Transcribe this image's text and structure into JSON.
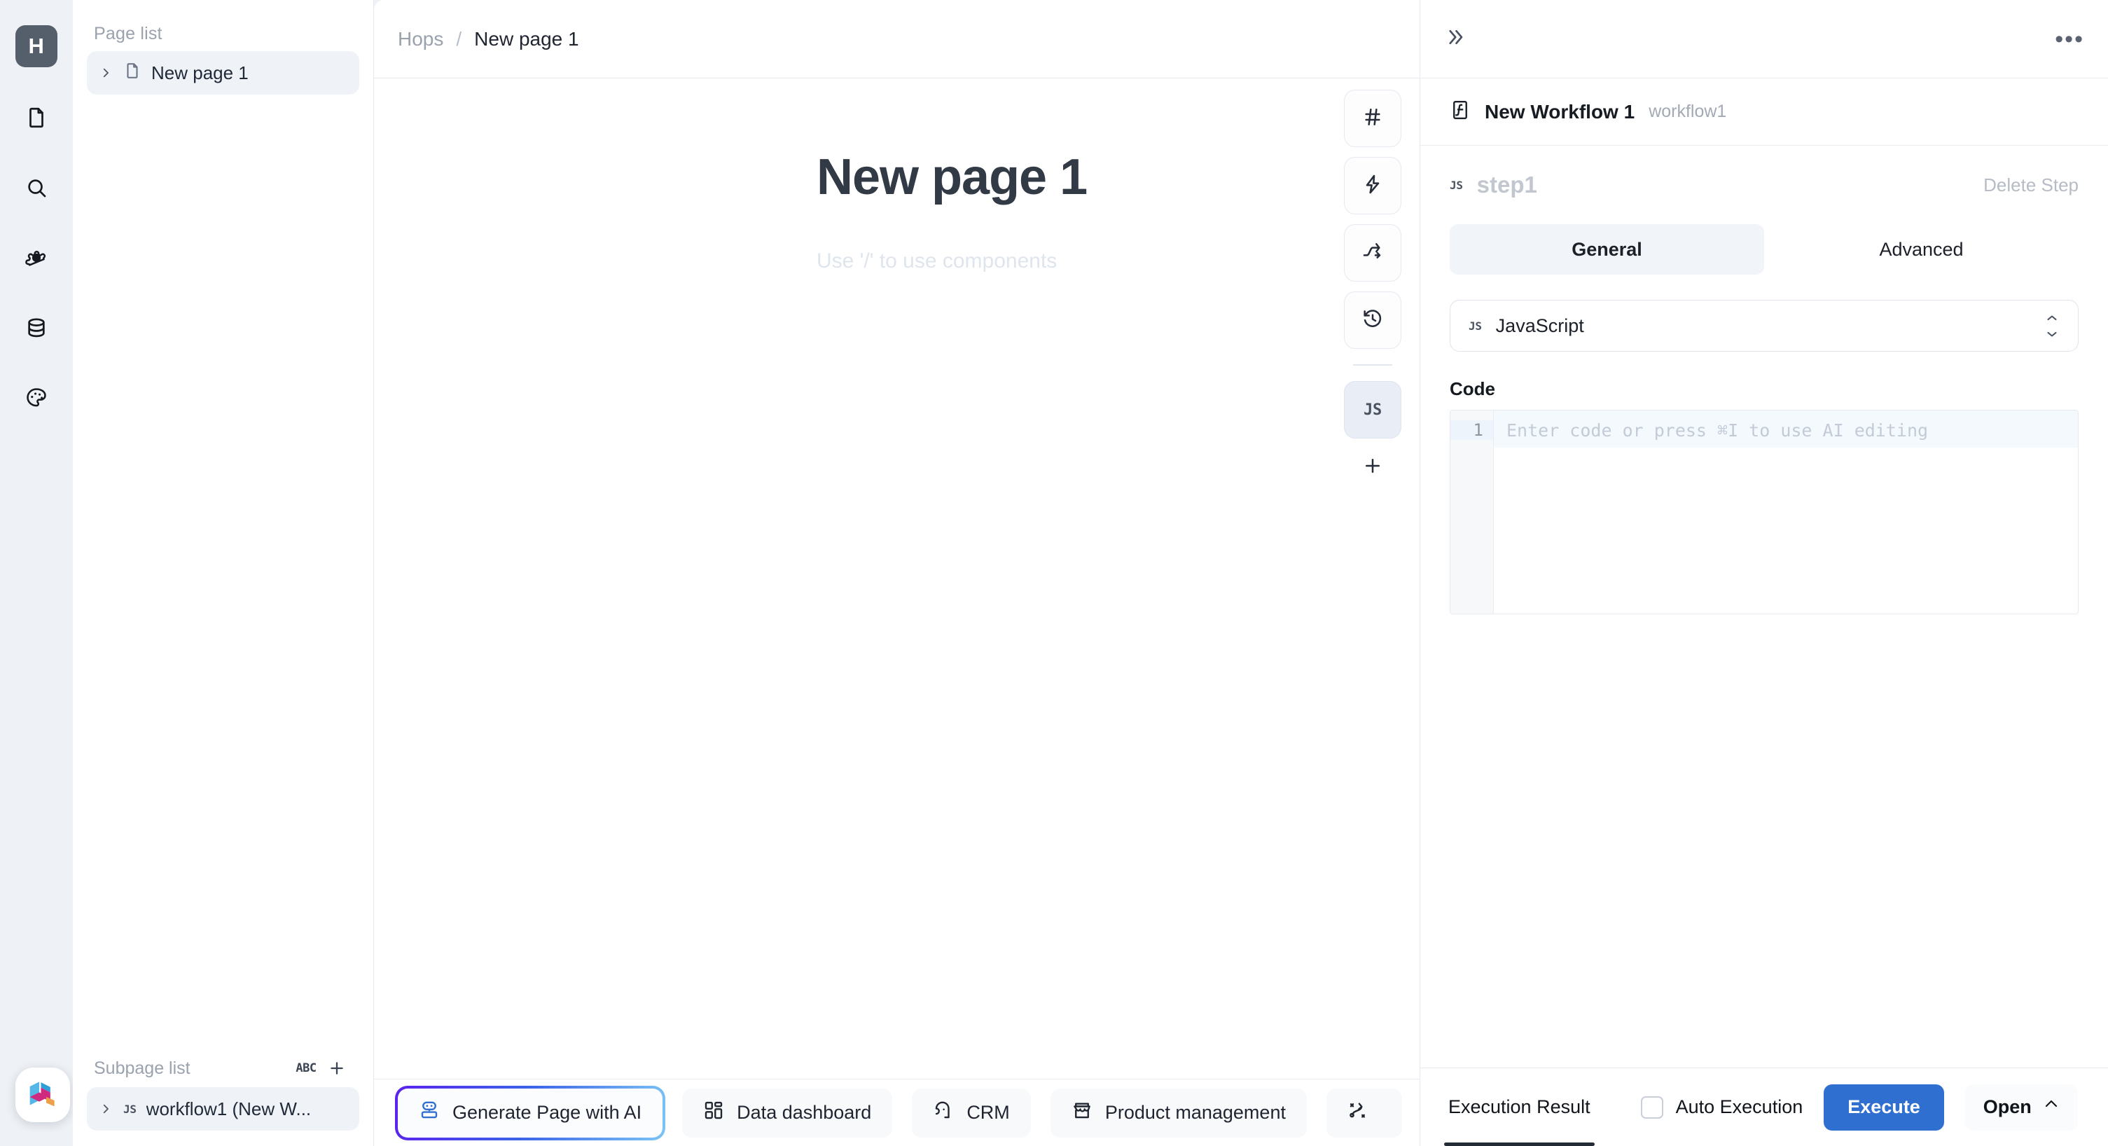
{
  "rail": {
    "logo_label": "H",
    "items": [
      {
        "name": "file-icon",
        "label": "Pages"
      },
      {
        "name": "search-icon",
        "label": "Search"
      },
      {
        "name": "gear-icon",
        "label": "Settings"
      },
      {
        "name": "database-icon",
        "label": "Resources"
      },
      {
        "name": "palette-icon",
        "label": "Theme"
      }
    ]
  },
  "pages_panel": {
    "page_list_title": "Page list",
    "pages": [
      {
        "label": "New page 1",
        "icon": "file-icon",
        "selected": true
      }
    ],
    "subpage_list_title": "Subpage list",
    "subpage_actions": {
      "sort_label": "ABC",
      "add_label": "+"
    },
    "subpages": [
      {
        "label": "workflow1 (New W...",
        "icon": "js-badge",
        "selected": true
      }
    ]
  },
  "breadcrumb": {
    "root": "Hops",
    "separator": "/",
    "current": "New page 1"
  },
  "canvas": {
    "title": "New page 1",
    "placeholder": "Use '/' to use components",
    "tools": [
      {
        "name": "heading-icon",
        "label": "#",
        "active": false
      },
      {
        "name": "lightning-icon",
        "label": "",
        "active": false
      },
      {
        "name": "shuffle-icon",
        "label": "",
        "active": false
      },
      {
        "name": "history-icon",
        "label": "",
        "active": false
      },
      {
        "name": "js-icon",
        "label": "JS",
        "active": true
      }
    ],
    "add_tool_label": "+"
  },
  "bottombar": {
    "items": [
      {
        "label": "Generate Page with AI",
        "icon": "robot-icon",
        "primary": true
      },
      {
        "label": "Data dashboard",
        "icon": "dashboard-icon",
        "primary": false
      },
      {
        "label": "CRM",
        "icon": "headset-icon",
        "primary": false
      },
      {
        "label": "Product management",
        "icon": "store-icon",
        "primary": false
      },
      {
        "label": "",
        "icon": "strategy-icon",
        "primary": false
      }
    ]
  },
  "right_panel": {
    "expand_label": "»",
    "more_label": "•••",
    "workflow": {
      "title": "New Workflow 1",
      "key": "workflow1",
      "icon": "workflow-icon"
    },
    "step": {
      "badge": "JS",
      "name": "step1",
      "delete_label": "Delete Step"
    },
    "tabs": [
      {
        "label": "General",
        "active": true
      },
      {
        "label": "Advanced",
        "active": false
      }
    ],
    "language_select": {
      "badge": "JS",
      "value": "JavaScript"
    },
    "code_label": "Code",
    "code_editor": {
      "line_number": "1",
      "placeholder": "Enter code or press ⌘I to use AI editing"
    },
    "footer": {
      "result_tab": "Execution Result",
      "auto_execution_label": "Auto Execution",
      "auto_execution_checked": false,
      "execute_label": "Execute",
      "open_label": "Open"
    }
  },
  "colors": {
    "accent_blue": "#2f6fd0",
    "ai_gradient_start": "#5b21ef",
    "ai_gradient_end": "#7cc5f5",
    "rail_logo_bg": "#555e6b",
    "panel_bg": "#ffffff",
    "app_bg": "#eef1f5"
  }
}
